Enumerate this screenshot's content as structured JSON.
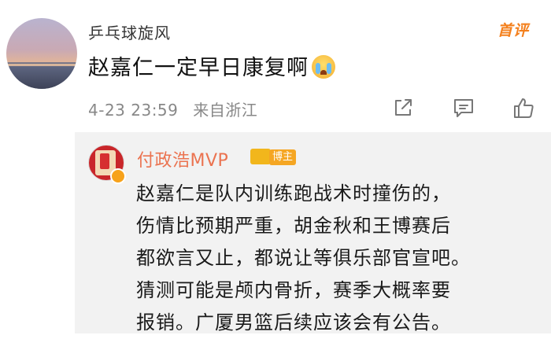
{
  "comment": {
    "username": "乒乓球旋风",
    "text": "赵嘉仁一定早日康复啊",
    "emoji_icon": "crying-face-icon",
    "time": "4-23 23:59",
    "location": "来自浙江",
    "hot_label": "首评"
  },
  "actions": [
    {
      "name": "share-icon"
    },
    {
      "name": "comment-icon"
    },
    {
      "name": "like-icon"
    }
  ],
  "reply": {
    "username": "付政浩MVP",
    "badge_label": "博主",
    "lines": [
      "赵嘉仁是队内训练跑战术时撞伤的，",
      "伤情比预期严重，胡金秋和王博赛后",
      "都欲言又止，都说让等俱乐部官宣吧。",
      "猜测可能是颅内骨折，赛季大概率要",
      "报销。广厦男篮后续应该会有公告。"
    ]
  },
  "colors": {
    "accent_orange": "#eb7350",
    "hot_orange": "#f4801d",
    "meta_gray": "#888888",
    "reply_bg": "#f2f2f2"
  }
}
